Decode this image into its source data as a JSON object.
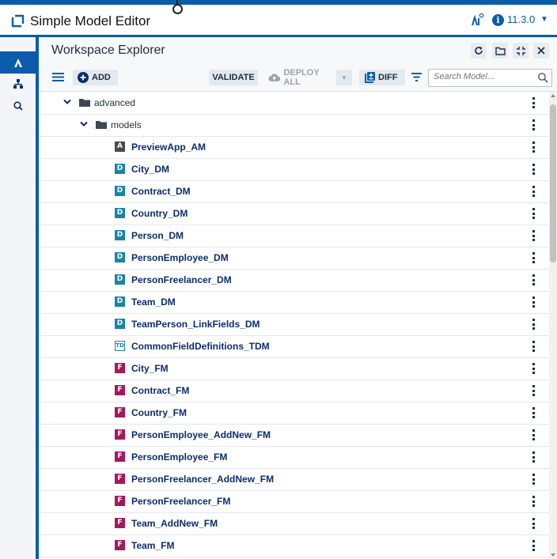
{
  "app": {
    "title": "Simple Model Editor",
    "version": "11.3.0",
    "icons": [
      "app-logo-icon",
      "ai-sparkle-icon",
      "info-icon",
      "chevron-down-icon"
    ]
  },
  "rail": {
    "items": [
      {
        "name": "explorer",
        "icon": "explorer-icon",
        "active": true
      },
      {
        "name": "hierarchy",
        "icon": "sitemap-icon",
        "active": false
      },
      {
        "name": "search",
        "icon": "search-icon",
        "active": false
      }
    ]
  },
  "workspace": {
    "title": "Workspace Explorer",
    "header_icons": [
      "refresh-icon",
      "folder-icon",
      "collapse-icon",
      "close-icon"
    ]
  },
  "toolbar": {
    "add_label": "ADD",
    "validate_label": "VALIDATE",
    "deploy_all_label": "DEPLOY ALL",
    "diff_label": "DIFF",
    "search_placeholder": "Search Model..."
  },
  "tree": {
    "folders": [
      {
        "label": "advanced",
        "level": 0
      },
      {
        "label": "models",
        "level": 1
      }
    ],
    "models": [
      {
        "badge": "A",
        "label": "PreviewApp_AM"
      },
      {
        "badge": "D",
        "label": "City_DM"
      },
      {
        "badge": "D",
        "label": "Contract_DM"
      },
      {
        "badge": "D",
        "label": "Country_DM"
      },
      {
        "badge": "D",
        "label": "Person_DM"
      },
      {
        "badge": "D",
        "label": "PersonEmployee_DM"
      },
      {
        "badge": "D",
        "label": "PersonFreelancer_DM"
      },
      {
        "badge": "D",
        "label": "Team_DM"
      },
      {
        "badge": "D",
        "label": "TeamPerson_LinkFields_DM"
      },
      {
        "badge": "TD",
        "label": "CommonFieldDefinitions_TDM"
      },
      {
        "badge": "F",
        "label": "City_FM"
      },
      {
        "badge": "F",
        "label": "Contract_FM"
      },
      {
        "badge": "F",
        "label": "Country_FM"
      },
      {
        "badge": "F",
        "label": "PersonEmployee_AddNew_FM"
      },
      {
        "badge": "F",
        "label": "PersonEmployee_FM"
      },
      {
        "badge": "F",
        "label": "PersonFreelancer_AddNew_FM"
      },
      {
        "badge": "F",
        "label": "PersonFreelancer_FM"
      },
      {
        "badge": "F",
        "label": "Team_AddNew_FM"
      },
      {
        "badge": "F",
        "label": "Team_FM"
      }
    ]
  },
  "colors": {
    "brand": "#0b5cab",
    "model_text": "#0b2d6b",
    "badge_app": "#4a4a4a",
    "badge_data": "#1a84a6",
    "badge_form": "#a6185c"
  }
}
